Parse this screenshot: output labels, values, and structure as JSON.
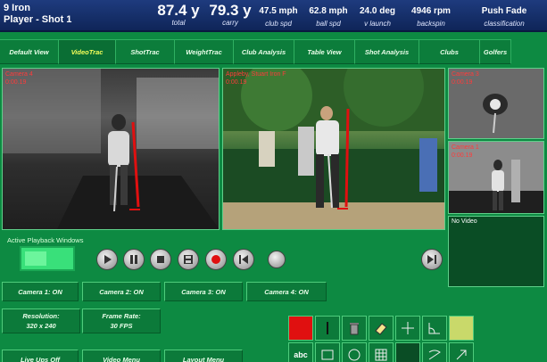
{
  "header": {
    "club": "9 Iron",
    "player": "Player - Shot 1",
    "metrics": [
      {
        "value": "87.4 y",
        "label": "total"
      },
      {
        "value": "79.3 y",
        "label": "carry"
      },
      {
        "value": "47.5 mph",
        "label": "club spd"
      },
      {
        "value": "62.8 mph",
        "label": "ball spd"
      },
      {
        "value": "24.0 deg",
        "label": "v launch"
      },
      {
        "value": "4946 rpm",
        "label": "backspin"
      },
      {
        "value": "Push Fade",
        "label": "classification"
      }
    ]
  },
  "tabs": [
    {
      "label": "Default View"
    },
    {
      "label": "VideoTrac",
      "active": true
    },
    {
      "label": "ShotTrac"
    },
    {
      "label": "WeightTrac"
    },
    {
      "label": "Club Analysis"
    },
    {
      "label": "Table View"
    },
    {
      "label": "Shot Analysis"
    },
    {
      "label": "Clubs"
    },
    {
      "label": "Golfers"
    }
  ],
  "cameras": {
    "cam4": {
      "name": "Camera 4",
      "time": "0:00.19"
    },
    "main": {
      "name": "Appleby, Stuart Iron F",
      "time": "0:00.19"
    },
    "cam3": {
      "name": "Camera 3",
      "time": "0:00.19"
    },
    "cam1": {
      "name": "Camera 1",
      "time": "0:00.19"
    },
    "no_video": "No Video"
  },
  "playback_label": "Active Playback Windows",
  "camera_buttons": [
    "Camera 1: ON",
    "Camera 2: ON",
    "Camera 3: ON",
    "Camera 4: ON"
  ],
  "resolution": {
    "label": "Resolution:",
    "value": "320 x 240"
  },
  "frame_rate": {
    "label": "Frame Rate:",
    "value": "30 FPS"
  },
  "bottom_buttons": [
    "Live Ups Off",
    "Video Menu",
    "Layout Menu"
  ],
  "tool_text": "abc",
  "colors": {
    "accent": "#f4ff5a",
    "record": "#e01010",
    "header": "#1e3b7e",
    "background": "#0d8a42"
  }
}
